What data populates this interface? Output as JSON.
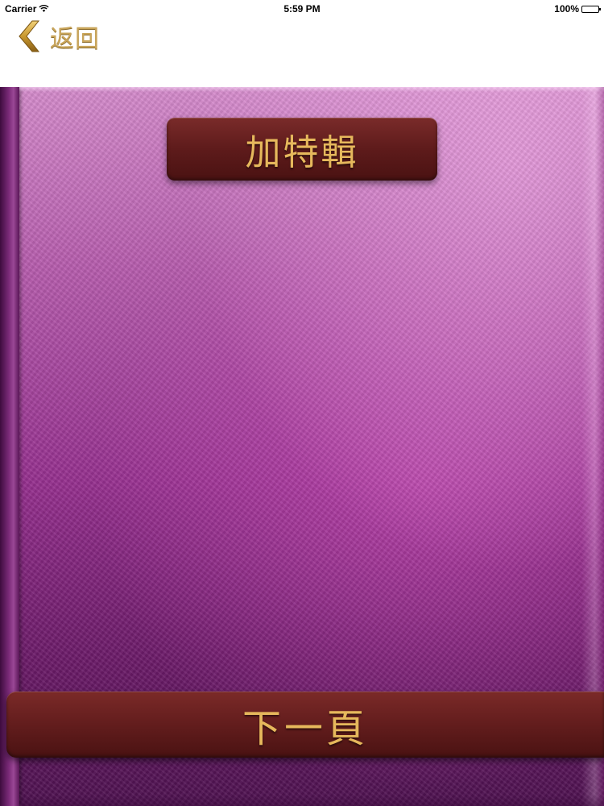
{
  "status_bar": {
    "carrier": "Carrier",
    "time": "5:59 PM",
    "battery": "100%",
    "battery_level": 1.0
  },
  "nav": {
    "back_label": "返回",
    "back_icon": "chevron-left-icon"
  },
  "book": {
    "title": "加特輯",
    "next_page_label": "下一頁"
  },
  "colors": {
    "gold_text": "#e6b85c",
    "plate_brown": "#5e1b1b",
    "cover_purple": "#96308f"
  }
}
